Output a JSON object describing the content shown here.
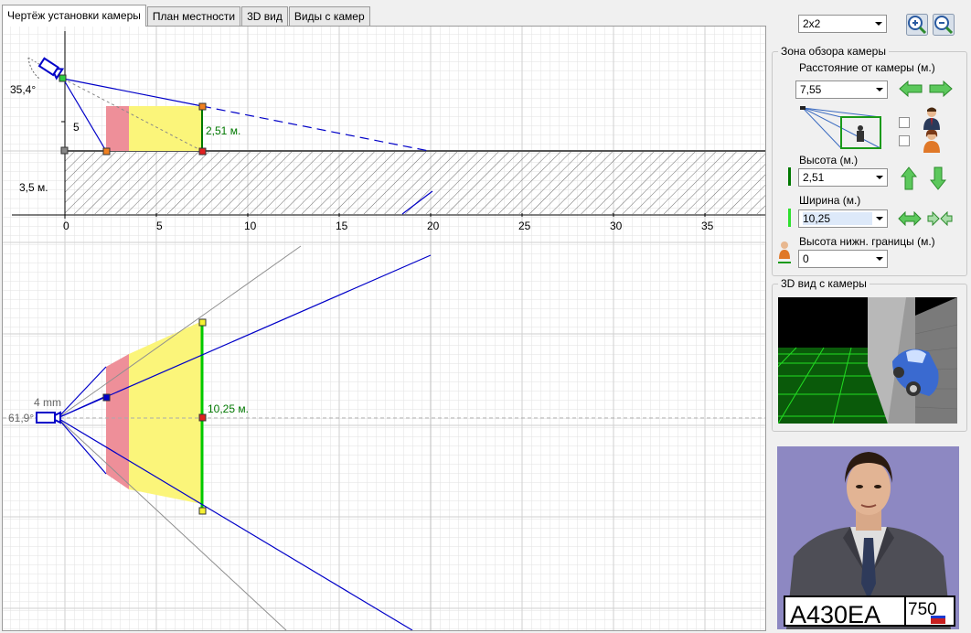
{
  "tabs": [
    "Чертёж установки камеры",
    "План местности",
    "3D вид",
    "Виды с камер"
  ],
  "drawing": {
    "angle_label": "35,4°",
    "five_label": "5",
    "height_label": "2,51 м.",
    "ground_label": "3,5 м.",
    "x_ticks": [
      "0",
      "5",
      "10",
      "15",
      "20",
      "25",
      "30",
      "35"
    ],
    "lens_label": "4 mm",
    "h_angle_label": "61,9°",
    "width_label": "10,25 м."
  },
  "sidebar": {
    "layout_value": "2x2",
    "zone_group_title": "Зона обзора камеры",
    "distance_label": "Расстояние от камеры (м.)",
    "distance_value": "7,55",
    "height_label": "Высота (м.)",
    "height_value": "2,51",
    "width_label": "Ширина (м.)",
    "width_value": "10,25",
    "lower_label": "Высота нижн. границы (м.)",
    "lower_value": "0",
    "view3d_title": "3D вид с камеры"
  },
  "plate": {
    "main": "А430ЕА",
    "region": "750"
  },
  "colors": {
    "pink": "#ee8f99",
    "yellow": "#fbf57a",
    "blue_line": "#0000c8",
    "green_line": "#00c800"
  }
}
